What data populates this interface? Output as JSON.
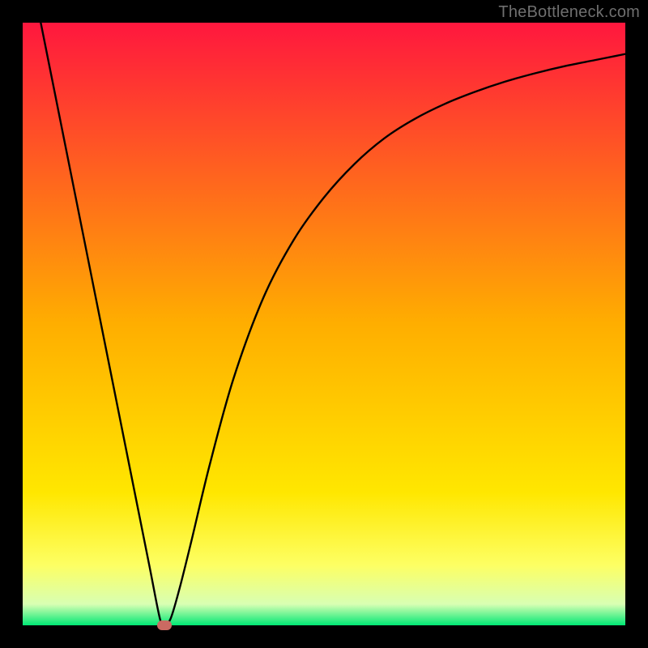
{
  "attribution": "TheBottleneck.com",
  "chart_data": {
    "type": "line",
    "title": "",
    "xlabel": "",
    "ylabel": "",
    "xlim": [
      0,
      1
    ],
    "ylim": [
      0,
      1
    ],
    "grid": false,
    "legend": false,
    "series": [
      {
        "name": "curve",
        "x": [
          0.03,
          0.06,
          0.09,
          0.12,
          0.15,
          0.18,
          0.21,
          0.228,
          0.235,
          0.245,
          0.26,
          0.28,
          0.31,
          0.35,
          0.4,
          0.45,
          0.5,
          0.55,
          0.6,
          0.65,
          0.7,
          0.75,
          0.8,
          0.85,
          0.9,
          0.95,
          1.0
        ],
        "y": [
          1.0,
          0.85,
          0.7,
          0.55,
          0.4,
          0.25,
          0.1,
          0.01,
          0.006,
          0.01,
          0.06,
          0.14,
          0.265,
          0.41,
          0.545,
          0.64,
          0.71,
          0.765,
          0.808,
          0.84,
          0.865,
          0.885,
          0.902,
          0.916,
          0.928,
          0.938,
          0.948
        ]
      }
    ],
    "marker": {
      "x": 0.235,
      "y": 0.0
    },
    "gradient_stops": [
      {
        "offset": 0.0,
        "color": "#ff173e"
      },
      {
        "offset": 0.5,
        "color": "#ffae00"
      },
      {
        "offset": 0.78,
        "color": "#ffe700"
      },
      {
        "offset": 0.9,
        "color": "#fdff63"
      },
      {
        "offset": 0.965,
        "color": "#d8ffb3"
      },
      {
        "offset": 1.0,
        "color": "#00e874"
      }
    ]
  }
}
